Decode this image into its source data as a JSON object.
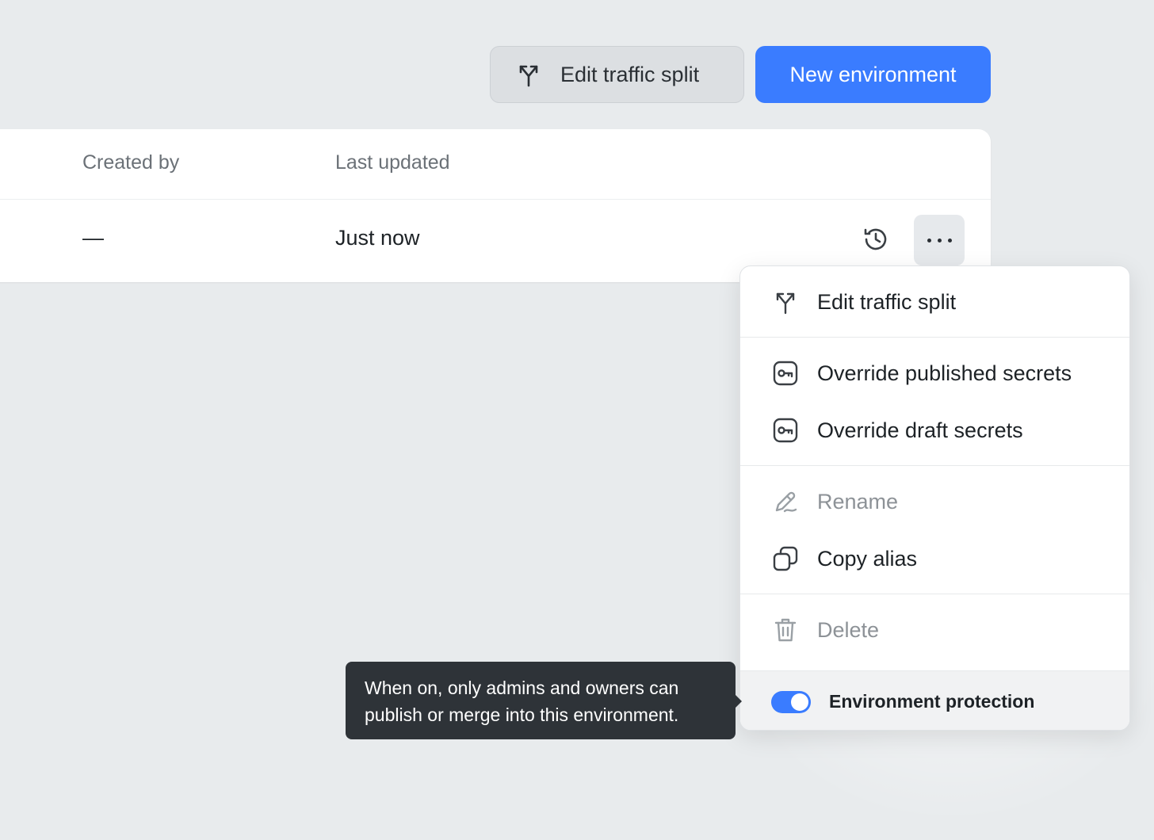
{
  "header": {
    "edit_traffic_split_label": "Edit traffic split",
    "new_environment_label": "New environment"
  },
  "table": {
    "columns": [
      "Created by",
      "Last updated"
    ],
    "rows": [
      {
        "created_by": "—",
        "last_updated": "Just now"
      }
    ]
  },
  "menu": {
    "items": [
      {
        "label": "Edit traffic split",
        "icon": "split-arrows-icon",
        "disabled": false
      },
      {
        "label": "Override published secrets",
        "icon": "key-icon",
        "disabled": false
      },
      {
        "label": "Override draft secrets",
        "icon": "key-icon",
        "disabled": false
      },
      {
        "label": "Rename",
        "icon": "pencil-icon",
        "disabled": true
      },
      {
        "label": "Copy alias",
        "icon": "copy-icon",
        "disabled": false
      },
      {
        "label": "Delete",
        "icon": "trash-icon",
        "disabled": true
      }
    ],
    "footer": {
      "label": "Environment protection",
      "toggle_on": true
    }
  },
  "tooltip": {
    "text": "When on, only admins and owners can publish or merge into this environment."
  },
  "colors": {
    "primary": "#3a7cff",
    "background": "#e8ebed",
    "tooltip_bg": "#2e3338"
  }
}
